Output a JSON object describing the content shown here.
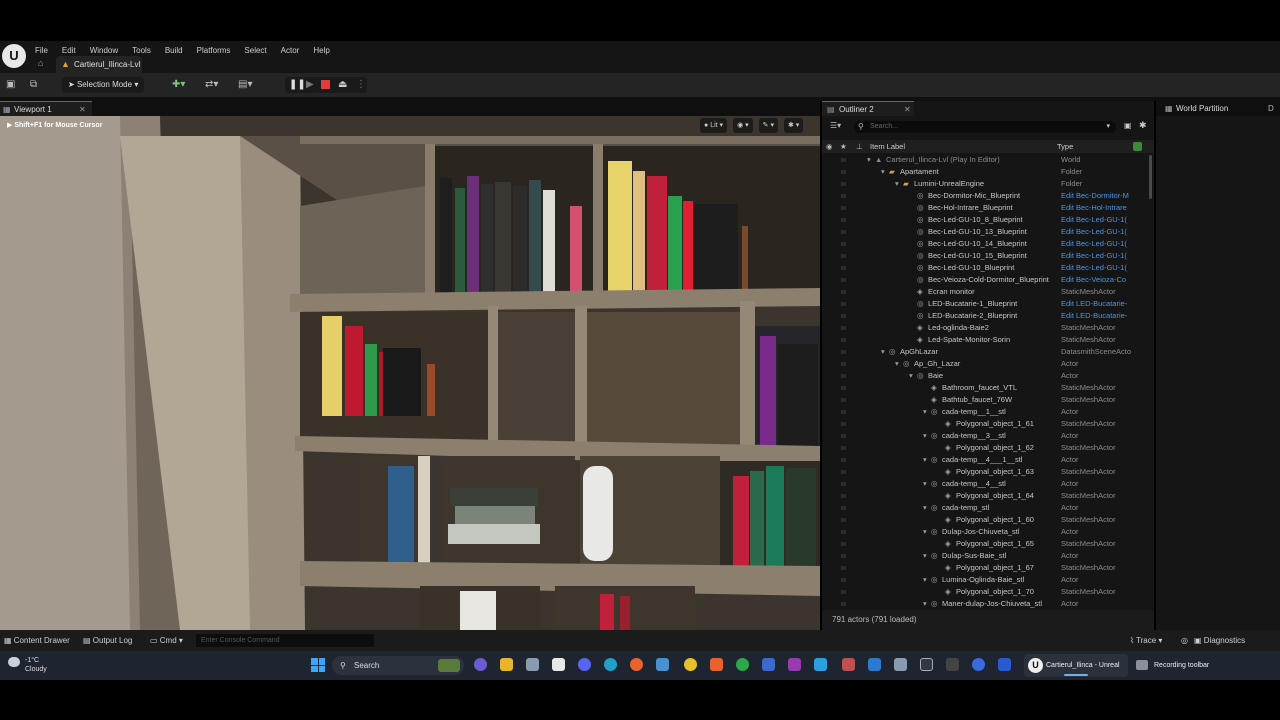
{
  "menu": {
    "items": [
      "File",
      "Edit",
      "Window",
      "Tools",
      "Build",
      "Platforms",
      "Select",
      "Actor",
      "Help"
    ],
    "project_tab": "Cartierul_Ilinca-Lvl"
  },
  "toolbar": {
    "selection_mode": "Selection Mode"
  },
  "viewport": {
    "tab_label": "Viewport 1",
    "hint": "Shift+F1 for Mouse Cursor",
    "view_mode": "Lit"
  },
  "outliner": {
    "tab_label": "Outliner 2",
    "search_placeholder": "Search...",
    "col_label": "Item Label",
    "col_type": "Type",
    "footer": "791 actors (791 loaded)",
    "rows": [
      {
        "label": "Cartierul_Ilinca-Lvl (Play In Editor)",
        "type": "World",
        "indent": 0,
        "icon": "world",
        "arrow": true,
        "dim": true
      },
      {
        "label": "Apartament",
        "type": "Folder",
        "indent": 1,
        "icon": "folder",
        "arrow": true
      },
      {
        "label": "Lumini-UnrealEngine",
        "type": "Folder",
        "indent": 2,
        "icon": "folder",
        "arrow": true
      },
      {
        "label": "Bec-Dormitor-Mic_Blueprint",
        "type": "Edit Bec-Dormitor-M",
        "indent": 3,
        "icon": "actor",
        "edit": true
      },
      {
        "label": "Bec-Hol-Intrare_Blueprint",
        "type": "Edit Bec-Hol-Intrare",
        "indent": 3,
        "icon": "actor",
        "edit": true
      },
      {
        "label": "Bec-Led-GU-10_8_Blueprint",
        "type": "Edit Bec-Led-GU-1(",
        "indent": 3,
        "icon": "actor",
        "edit": true
      },
      {
        "label": "Bec-Led-GU-10_13_Blueprint",
        "type": "Edit Bec-Led-GU-1(",
        "indent": 3,
        "icon": "actor",
        "edit": true
      },
      {
        "label": "Bec-Led-GU-10_14_Blueprint",
        "type": "Edit Bec-Led-GU-1(",
        "indent": 3,
        "icon": "actor",
        "edit": true
      },
      {
        "label": "Bec-Led-GU-10_15_Blueprint",
        "type": "Edit Bec-Led-GU-1(",
        "indent": 3,
        "icon": "actor",
        "edit": true
      },
      {
        "label": "Bec-Led-GU-10_Blueprint",
        "type": "Edit Bec-Led-GU-1(",
        "indent": 3,
        "icon": "actor",
        "edit": true
      },
      {
        "label": "Bec-Veioza-Cold-Dormitor_Blueprint",
        "type": "Edit Bec-Veioza-Co",
        "indent": 3,
        "icon": "actor",
        "edit": true
      },
      {
        "label": "Ecran monitor",
        "type": "StaticMeshActor",
        "indent": 3,
        "icon": "mesh"
      },
      {
        "label": "LED-Bucatarie-1_Blueprint",
        "type": "Edit LED-Bucatarie-",
        "indent": 3,
        "icon": "actor",
        "edit": true
      },
      {
        "label": "LED-Bucatarie-2_Blueprint",
        "type": "Edit LED-Bucatarie-",
        "indent": 3,
        "icon": "actor",
        "edit": true
      },
      {
        "label": "Led-oglinda-Baie2",
        "type": "StaticMeshActor",
        "indent": 3,
        "icon": "mesh"
      },
      {
        "label": "Led-Spate-Monitor-Sorin",
        "type": "StaticMeshActor",
        "indent": 3,
        "icon": "mesh"
      },
      {
        "label": "ApGhLazar",
        "type": "DatasmithSceneActo",
        "indent": 1,
        "icon": "actor",
        "arrow": true
      },
      {
        "label": "Ap_Gh_Lazar",
        "type": "Actor",
        "indent": 2,
        "icon": "actor",
        "arrow": true
      },
      {
        "label": "Baie",
        "type": "Actor",
        "indent": 3,
        "icon": "actor",
        "arrow": true
      },
      {
        "label": "Bathroom_faucet_VTL",
        "type": "StaticMeshActor",
        "indent": 4,
        "icon": "mesh"
      },
      {
        "label": "Bathtub_faucet_76W",
        "type": "StaticMeshActor",
        "indent": 4,
        "icon": "mesh"
      },
      {
        "label": "cada-temp__1__stl",
        "type": "Actor",
        "indent": 4,
        "icon": "actor",
        "arrow": true
      },
      {
        "label": "Polygonal_object_1_61",
        "type": "StaticMeshActor",
        "indent": 5,
        "icon": "mesh"
      },
      {
        "label": "cada-temp__3__stl",
        "type": "Actor",
        "indent": 4,
        "icon": "actor",
        "arrow": true
      },
      {
        "label": "Polygonal_object_1_62",
        "type": "StaticMeshActor",
        "indent": 5,
        "icon": "mesh"
      },
      {
        "label": "cada-temp__4___1__stl",
        "type": "Actor",
        "indent": 4,
        "icon": "actor",
        "arrow": true
      },
      {
        "label": "Polygonal_object_1_63",
        "type": "StaticMeshActor",
        "indent": 5,
        "icon": "mesh"
      },
      {
        "label": "cada-temp__4__stl",
        "type": "Actor",
        "indent": 4,
        "icon": "actor",
        "arrow": true
      },
      {
        "label": "Polygonal_object_1_64",
        "type": "StaticMeshActor",
        "indent": 5,
        "icon": "mesh"
      },
      {
        "label": "cada-temp_stl",
        "type": "Actor",
        "indent": 4,
        "icon": "actor",
        "arrow": true
      },
      {
        "label": "Polygonal_object_1_60",
        "type": "StaticMeshActor",
        "indent": 5,
        "icon": "mesh"
      },
      {
        "label": "Dulap-Jos-Chiuveta_stl",
        "type": "Actor",
        "indent": 4,
        "icon": "actor",
        "arrow": true
      },
      {
        "label": "Polygonal_object_1_65",
        "type": "StaticMeshActor",
        "indent": 5,
        "icon": "mesh"
      },
      {
        "label": "Dulap-Sus-Baie_stl",
        "type": "Actor",
        "indent": 4,
        "icon": "actor",
        "arrow": true
      },
      {
        "label": "Polygonal_object_1_67",
        "type": "StaticMeshActor",
        "indent": 5,
        "icon": "mesh"
      },
      {
        "label": "Lumina-Oglinda-Baie_stl",
        "type": "Actor",
        "indent": 4,
        "icon": "actor",
        "arrow": true
      },
      {
        "label": "Polygonal_object_1_70",
        "type": "StaticMeshActor",
        "indent": 5,
        "icon": "mesh"
      },
      {
        "label": "Maner-dulap-Jos-Chiuveta_stl",
        "type": "Actor",
        "indent": 4,
        "icon": "actor",
        "arrow": true
      }
    ]
  },
  "world_partition": {
    "tab_label": "World Partition",
    "extra_tab": "D"
  },
  "statusbar": {
    "content_drawer": "Content Drawer",
    "output_log": "Output Log",
    "cmd": "Cmd",
    "console_placeholder": "Enter Console Command",
    "trace": "Trace",
    "diagnostics": "Diagnostics"
  },
  "taskbar": {
    "temperature": "-1°C",
    "condition": "Cloudy",
    "search": "Search",
    "unreal_window": "Cartierul_Ilinca - Unreal",
    "recording": "Recording toolbar"
  },
  "colors": {
    "accent": "#1e78d2",
    "edit_link": "#4a96e6",
    "play_stop": "#e23b3b",
    "folder": "#d9a441"
  }
}
